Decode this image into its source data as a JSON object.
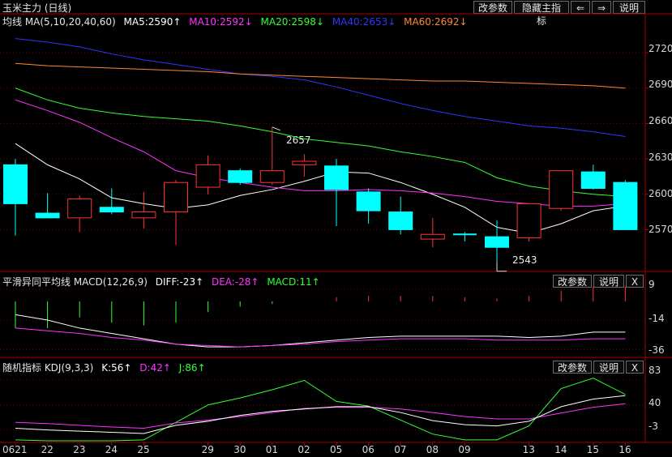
{
  "window": {
    "title": "玉米主力 (日线)",
    "toolbar": [
      "改参数",
      "隐藏主指标",
      "⇐",
      "⇒",
      "说明"
    ]
  },
  "main_panel": {
    "legend": [
      {
        "text": "均线  MA(5,10,20,40,60)",
        "color": "#e6e6e6"
      },
      {
        "text": "MA5:2590↑",
        "color": "#ffffff"
      },
      {
        "text": "MA10:2592↓",
        "color": "#ff33ff"
      },
      {
        "text": "MA20:2598↓",
        "color": "#33ff33"
      },
      {
        "text": "MA40:2653↓",
        "color": "#3333ff"
      },
      {
        "text": "MA60:2692↓",
        "color": "#ff8833"
      }
    ],
    "y_ticks": [
      "2720",
      "2690",
      "2660",
      "2630",
      "2600",
      "2570"
    ],
    "annotations": {
      "high": "2657",
      "low": "2543"
    }
  },
  "macd_panel": {
    "legend": [
      {
        "text": "平滑异同平均线  MACD(12,26,9)",
        "color": "#e6e6e6"
      },
      {
        "text": "DIFF:-23↑",
        "color": "#ffffff"
      },
      {
        "text": "DEA:-28↑",
        "color": "#ff33ff"
      },
      {
        "text": "MACD:11↑",
        "color": "#33ff33"
      }
    ],
    "buttons": [
      "改参数",
      "说明",
      "X"
    ],
    "y_ticks": [
      "9",
      "-14",
      "-36"
    ]
  },
  "kdj_panel": {
    "legend": [
      {
        "text": "随机指标  KDJ(9,3,3)",
        "color": "#e6e6e6"
      },
      {
        "text": "K:56↑",
        "color": "#ffffff"
      },
      {
        "text": "D:42↑",
        "color": "#ff33ff"
      },
      {
        "text": "J:86↑",
        "color": "#33ff33"
      }
    ],
    "buttons": [
      "改参数",
      "说明",
      "X"
    ],
    "y_ticks": [
      "83",
      "40",
      "-3"
    ]
  },
  "dates": [
    "0621",
    "22",
    "23",
    "24",
    "25",
    "29",
    "30",
    "01",
    "02",
    "05",
    "06",
    "07",
    "08",
    "09",
    "13",
    "14",
    "15",
    "16"
  ],
  "colors": {
    "up": "#ff3333",
    "down": "#00ffff",
    "grid": "#7a0000",
    "axis": "#aa0000"
  },
  "chart_data": {
    "type": "candlestick",
    "candles": [
      {
        "o": 2625,
        "h": 2630,
        "l": 2565,
        "c": 2592
      },
      {
        "o": 2584,
        "h": 2601,
        "l": 2580,
        "c": 2580
      },
      {
        "o": 2580,
        "h": 2599,
        "l": 2568,
        "c": 2596
      },
      {
        "o": 2589,
        "h": 2605,
        "l": 2583,
        "c": 2585
      },
      {
        "o": 2580,
        "h": 2602,
        "l": 2571,
        "c": 2585
      },
      {
        "o": 2585,
        "h": 2612,
        "l": 2557,
        "c": 2610
      },
      {
        "o": 2606,
        "h": 2633,
        "l": 2600,
        "c": 2625
      },
      {
        "o": 2620,
        "h": 2622,
        "l": 2608,
        "c": 2610
      },
      {
        "o": 2610,
        "h": 2657,
        "l": 2608,
        "c": 2620
      },
      {
        "o": 2625,
        "h": 2634,
        "l": 2615,
        "c": 2628
      },
      {
        "o": 2624,
        "h": 2630,
        "l": 2573,
        "c": 2604
      },
      {
        "o": 2602,
        "h": 2605,
        "l": 2575,
        "c": 2586
      },
      {
        "o": 2585,
        "h": 2598,
        "l": 2566,
        "c": 2570
      },
      {
        "o": 2562,
        "h": 2580,
        "l": 2555,
        "c": 2566
      },
      {
        "o": 2566,
        "h": 2568,
        "l": 2560,
        "c": 2566
      },
      {
        "o": 2564,
        "h": 2578,
        "l": 2543,
        "c": 2555
      },
      {
        "o": 2563,
        "h": 2592,
        "l": 2560,
        "c": 2592
      },
      {
        "o": 2588,
        "h": 2620,
        "l": 2586,
        "c": 2620
      },
      {
        "o": 2619,
        "h": 2625,
        "l": 2604,
        "c": 2605
      },
      {
        "o": 2610,
        "h": 2612,
        "l": 2570,
        "c": 2570
      }
    ],
    "ma": [
      {
        "name": "MA5",
        "color": "#ffffff",
        "values": [
          2643,
          2625,
          2613,
          2597,
          2592,
          2588,
          2591,
          2599,
          2604,
          2611,
          2619,
          2618,
          2610,
          2600,
          2589,
          2572,
          2567,
          2575,
          2586,
          2590
        ]
      },
      {
        "name": "MA10",
        "color": "#ff33ff",
        "values": [
          2680,
          2671,
          2661,
          2648,
          2636,
          2620,
          2614,
          2610,
          2606,
          2603,
          2603,
          2604,
          2603,
          2601,
          2598,
          2594,
          2592,
          2590,
          2590,
          2592
        ]
      },
      {
        "name": "MA20",
        "color": "#33ff33",
        "values": [
          2690,
          2680,
          2673,
          2669,
          2666,
          2664,
          2662,
          2658,
          2653,
          2647,
          2644,
          2641,
          2636,
          2632,
          2627,
          2614,
          2607,
          2603,
          2600,
          2598
        ]
      },
      {
        "name": "MA40",
        "color": "#3333ff",
        "values": [
          2732,
          2729,
          2725,
          2719,
          2714,
          2710,
          2706,
          2702,
          2700,
          2697,
          2691,
          2684,
          2677,
          2671,
          2666,
          2662,
          2658,
          2656,
          2653,
          2649
        ]
      },
      {
        "name": "MA60",
        "color": "#ff8833",
        "values": [
          2711,
          2709,
          2708,
          2707,
          2706,
          2705,
          2704,
          2702,
          2701,
          2700,
          2699,
          2698,
          2697,
          2696,
          2696,
          2695,
          2694,
          2693,
          2692,
          2690
        ]
      }
    ],
    "ylim": [
      2538,
      2740
    ],
    "macd": {
      "ylim": [
        -40,
        12
      ],
      "hist": [
        -20,
        -20,
        -12,
        -16,
        -18,
        -16,
        -8,
        -4,
        -2,
        0,
        3,
        4,
        4,
        4,
        3,
        2,
        4,
        8,
        11,
        11
      ],
      "diff": [
        -10,
        -14,
        -20,
        -24,
        -28,
        -32,
        -34,
        -34,
        -33,
        -31,
        -29,
        -27,
        -26,
        -26,
        -26,
        -26,
        -27,
        -26,
        -23,
        -23
      ],
      "dea": [
        -20,
        -22,
        -24,
        -27,
        -29,
        -32,
        -33,
        -34,
        -33,
        -32,
        -30,
        -29,
        -28,
        -28,
        -28,
        -29,
        -29,
        -29,
        -28,
        -28
      ]
    },
    "kdj": {
      "ylim": [
        -16,
        98
      ],
      "k": [
        0,
        -3,
        -5,
        -7,
        -9,
        5,
        12,
        22,
        29,
        33,
        37,
        37,
        27,
        13,
        6,
        4,
        12,
        37,
        50,
        56
      ],
      "d": [
        10,
        8,
        5,
        2,
        0,
        9,
        14,
        20,
        27,
        34,
        36,
        36,
        33,
        27,
        20,
        16,
        16,
        26,
        36,
        42
      ],
      "j": [
        -20,
        -23,
        -30,
        -25,
        -20,
        10,
        40,
        52,
        66,
        82,
        46,
        38,
        14,
        -10,
        -20,
        -20,
        4,
        68,
        86,
        58
      ]
    }
  }
}
